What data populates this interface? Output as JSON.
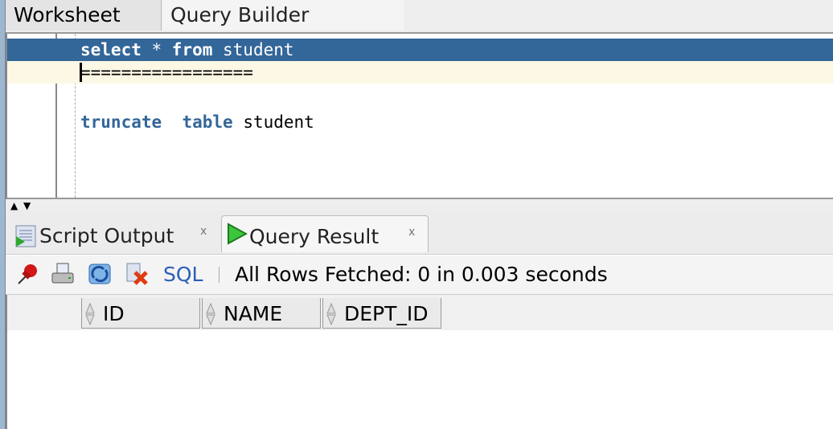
{
  "editor_tabs": [
    {
      "label": "Worksheet",
      "active": true
    },
    {
      "label": "Query Builder",
      "active": false
    }
  ],
  "editor": {
    "lines": [
      {
        "parts": [
          "select",
          " * ",
          "from",
          " student"
        ]
      },
      {
        "text": "================="
      },
      {
        "parts": [
          "truncate",
          "  ",
          "table",
          " student"
        ]
      }
    ],
    "selection_color": "#336699",
    "keyword_color": "#336699"
  },
  "output_tabs": [
    {
      "label": "Script Output",
      "close": "x",
      "icon": "script-output-icon"
    },
    {
      "label": "Query Result",
      "close": "x",
      "icon": "play-icon",
      "active": true
    }
  ],
  "toolbar": {
    "icons": [
      "pin-icon",
      "print-icon",
      "refresh-icon",
      "delete-icon"
    ],
    "sql_label": "SQL",
    "status": "All Rows Fetched: 0 in 0.003 seconds"
  },
  "result_table": {
    "columns": [
      "ID",
      "NAME",
      "DEPT_ID"
    ],
    "rows": []
  }
}
